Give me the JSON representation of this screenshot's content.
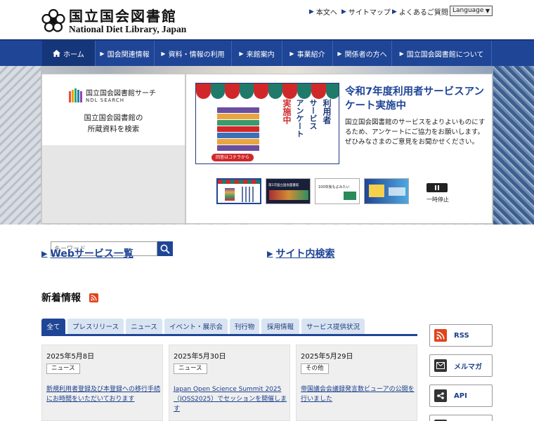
{
  "header": {
    "logo_jp": "国立国会図書館",
    "logo_en": "National Diet Library, Japan",
    "util_links": [
      {
        "label": "本文へ"
      },
      {
        "label": "サイトマップ"
      },
      {
        "label": "よくあるご質問"
      }
    ],
    "language_label": "Language"
  },
  "nav": {
    "items": [
      {
        "label": "ホーム",
        "icon": "home-icon"
      },
      {
        "label": "国会関連情報"
      },
      {
        "label": "資料・情報の利用"
      },
      {
        "label": "来館案内"
      },
      {
        "label": "事業紹介"
      },
      {
        "label": "関係者の方へ"
      },
      {
        "label": "国立国会図書館について"
      }
    ]
  },
  "search": {
    "logo_jp": "国立国会図書館サーチ",
    "logo_en": "NDL SEARCH",
    "desc_line1": "国立国会図書館の",
    "desc_line2": "所蔵資料を検索",
    "placeholder": "キーワード"
  },
  "slide": {
    "img_col1": "利用者",
    "img_col2": "サービス",
    "img_col3": "アンケート",
    "img_col4": "実施中",
    "img_button": "回答はコチラから",
    "title": "令和7年度利用者サービスアンケート実施中",
    "text": "国立国会図書館のサービスをよりよいものにするため、アンケートにご協力をお願いします。ぜひみなさまのご意見をお聞かせください。",
    "pause_label": "一時停止",
    "thumb2_text": "第2次国立国会図書館",
    "thumb3_text": "100年後もよみたい"
  },
  "quick_links": [
    {
      "label": "Webサービス一覧"
    },
    {
      "label": "サイト内検索"
    }
  ],
  "news": {
    "heading": "新着情報",
    "tabs": [
      {
        "label": "全て"
      },
      {
        "label": "プレスリリース"
      },
      {
        "label": "ニュース"
      },
      {
        "label": "イベント・展示会"
      },
      {
        "label": "刊行物"
      },
      {
        "label": "採用情報"
      },
      {
        "label": "サービス提供状況"
      }
    ],
    "cards": [
      {
        "date": "2025年5月8日",
        "category": "ニュース",
        "title": "新規利用者登録及び本登録への移行手続にお時間をいただいております"
      },
      {
        "date": "2025年5月30日",
        "category": "ニュース",
        "title": "Japan Open Science Summit 2025（JOSS2025）でセッションを開催します"
      },
      {
        "date": "2025年5月29日",
        "category": "その他",
        "title": "帝国議会会議録発言数ビューアの公開を行いました"
      }
    ]
  },
  "side_links": [
    {
      "label": "RSS",
      "icon": "rss-icon"
    },
    {
      "label": "メルマガ",
      "icon": "mail-icon"
    },
    {
      "label": "API",
      "icon": "api-icon"
    }
  ],
  "colors": {
    "brand": "#1f4596",
    "accent_red": "#d0282a",
    "rss": "#e0441b"
  }
}
